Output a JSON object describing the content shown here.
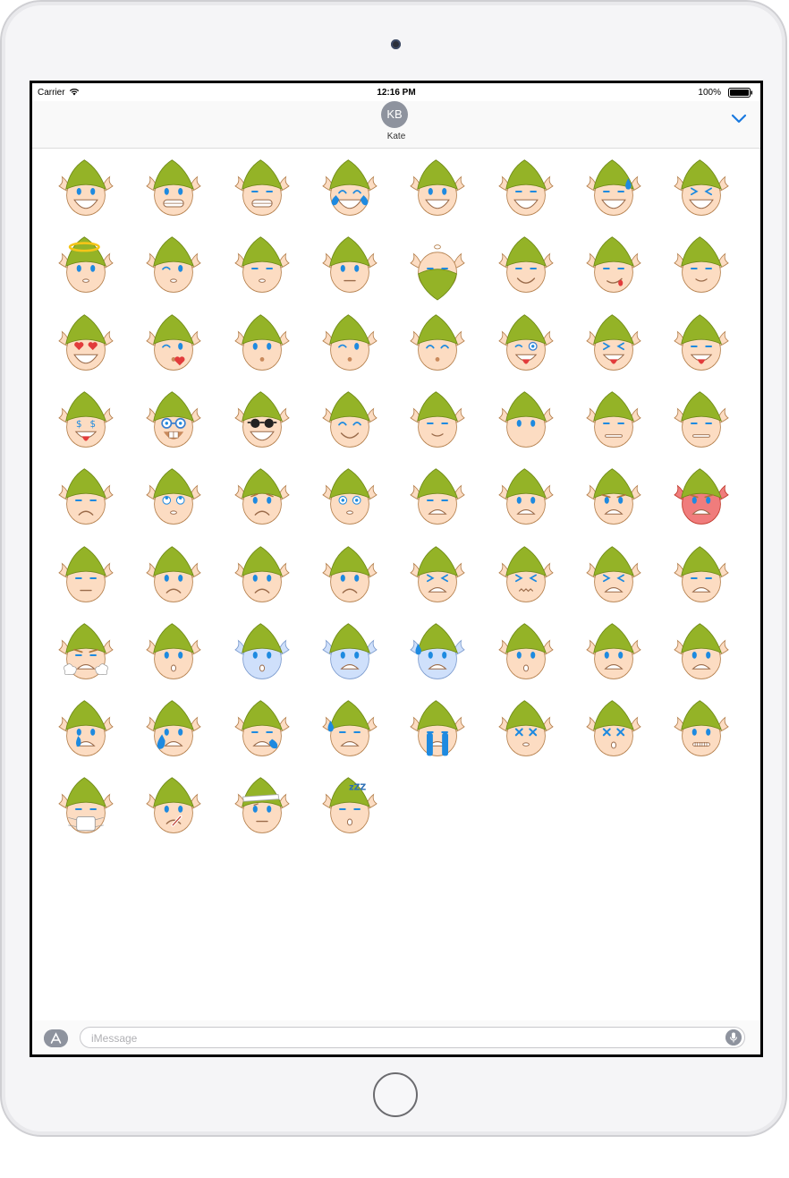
{
  "status_bar": {
    "carrier": "Carrier",
    "time": "12:16 PM",
    "battery": "100%",
    "wifi_icon": "wifi-icon",
    "battery_icon": "battery-icon"
  },
  "header": {
    "avatar_initials": "KB",
    "contact_name": "Kate",
    "collapse_icon": "chevron-down-icon",
    "accent_color": "#1a7ae0"
  },
  "composer": {
    "placeholder": "iMessage",
    "app_store_icon": "app-store-icon",
    "mic_icon": "microphone-icon"
  },
  "colors": {
    "hat": "#94b327",
    "skin": "#fcdcc2",
    "eye": "#1e8ae0",
    "angry_face": "#f07c7c",
    "cold_face": "#cfe0fb"
  },
  "stickers": [
    "elf-grin",
    "elf-smile-teeth",
    "elf-happy-squint",
    "elf-tears-of-joy",
    "elf-smile",
    "elf-smile-closed-eyes",
    "elf-sweat-smile",
    "elf-laughing-squint",
    "elf-angel",
    "elf-calm",
    "elf-content",
    "elf-relieved",
    "elf-bald-bearded",
    "elf-smirk",
    "elf-tongue-wink",
    "elf-relaxed",
    "elf-heart-eyes",
    "elf-kiss-heart",
    "elf-kiss",
    "elf-kiss-wink",
    "elf-kiss-smiling",
    "elf-monocle",
    "elf-tongue-squint",
    "elf-tongue-out",
    "elf-money-eyes",
    "elf-nerd",
    "elf-sunglasses",
    "elf-blissful",
    "elf-smirk-side",
    "elf-neutral",
    "elf-expressionless",
    "elf-unamused",
    "elf-disappointed",
    "elf-eye-roll",
    "elf-worried",
    "elf-surprised",
    "elf-grimace",
    "elf-anguished",
    "elf-angry",
    "elf-enraged",
    "elf-pensive",
    "elf-confused",
    "elf-frowning",
    "elf-sad",
    "elf-persevering",
    "elf-confounded",
    "elf-tired",
    "elf-weary",
    "elf-triumph",
    "elf-astonished",
    "elf-scream-cold",
    "elf-fearful-cold",
    "elf-cold-sweat",
    "elf-hushed",
    "elf-open-mouth",
    "elf-gasp",
    "elf-crying",
    "elf-disappointed-tear",
    "elf-sob-single",
    "elf-sweat-drop",
    "elf-loud-crying",
    "elf-dizzy",
    "elf-dizzy-shocked",
    "elf-zipper-mouth",
    "elf-mask",
    "elf-thermometer",
    "elf-bandaged",
    "elf-sleeping"
  ],
  "sleep_label": "zZZ"
}
